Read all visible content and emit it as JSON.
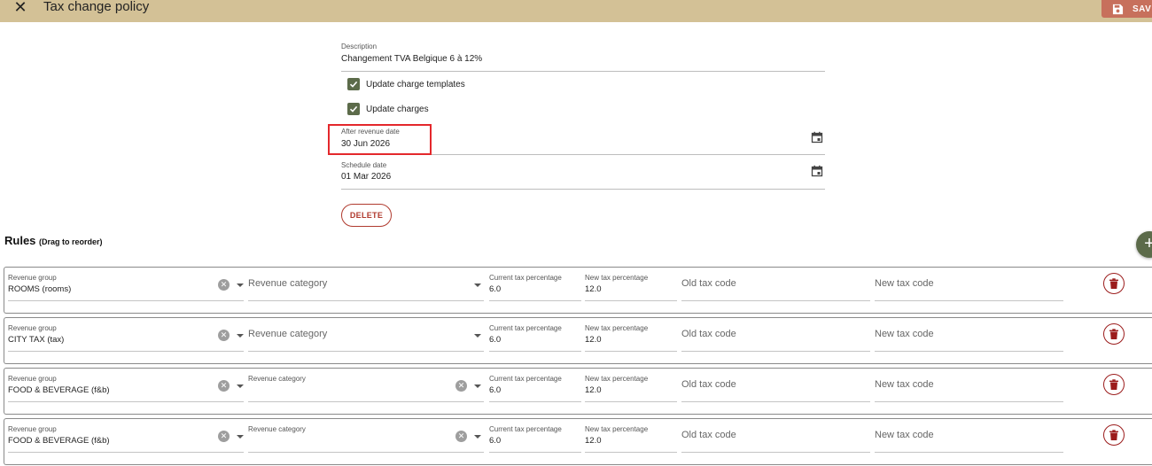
{
  "header": {
    "title": "Tax change policy",
    "save_label": "SAVE",
    "close_icon": "close-icon",
    "save_icon": "floppy-disk-icon"
  },
  "form": {
    "description": {
      "label": "Description",
      "value": "Changement TVA Belgique 6 à 12%"
    },
    "update_charge_templates": {
      "label": "Update charge templates",
      "checked": true
    },
    "update_charges": {
      "label": "Update charges",
      "checked": true
    },
    "after_revenue_date": {
      "label": "After revenue date",
      "value": "30 Jun 2026"
    },
    "schedule_date": {
      "label": "Schedule date",
      "value": "01 Mar 2026"
    },
    "delete_label": "DELETE"
  },
  "rules": {
    "title": "Rules",
    "subtitle": "(Drag to reorder)",
    "add_icon": "plus-icon",
    "labels": {
      "revenue_group": "Revenue group",
      "revenue_category": "Revenue category",
      "current_tax": "Current tax percentage",
      "new_tax": "New tax percentage",
      "old_tax_code": "Old tax code",
      "new_tax_code": "New tax code"
    },
    "rows": [
      {
        "revenue_group": "ROOMS (rooms)",
        "revenue_category": "",
        "current_tax": "6.0",
        "new_tax": "12.0",
        "old_tax_code": "",
        "new_tax_code": ""
      },
      {
        "revenue_group": "CITY TAX (tax)",
        "revenue_category": "",
        "current_tax": "6.0",
        "new_tax": "12.0",
        "old_tax_code": "",
        "new_tax_code": ""
      },
      {
        "revenue_group": "FOOD & BEVERAGE (f&b)",
        "revenue_category": "",
        "current_tax": "6.0",
        "new_tax": "12.0",
        "old_tax_code": "",
        "new_tax_code": ""
      },
      {
        "revenue_group": "FOOD & BEVERAGE (f&b)",
        "revenue_category": "",
        "current_tax": "6.0",
        "new_tax": "12.0",
        "old_tax_code": "",
        "new_tax_code": ""
      }
    ]
  },
  "colors": {
    "header_bg": "#d3c196",
    "save_bg": "#c7705c",
    "checkbox": "#5c6b4a",
    "delete_accent": "#b03a2e",
    "highlight": "#e4282c"
  }
}
